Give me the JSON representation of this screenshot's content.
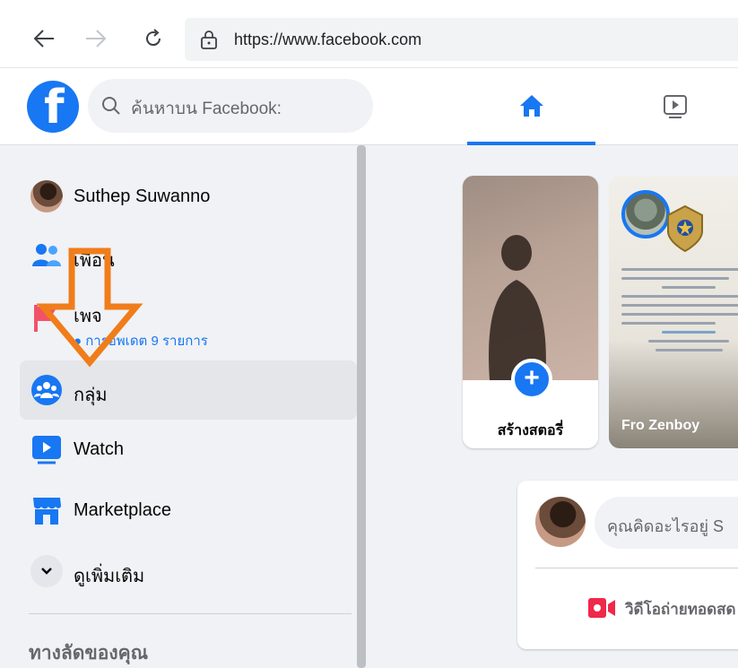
{
  "browser": {
    "url": "https://www.facebook.com"
  },
  "header": {
    "logo_letter": "f",
    "search_placeholder": "ค้นหาบน Facebook:"
  },
  "sidebar": {
    "items": [
      {
        "label": "Suthep Suwanno"
      },
      {
        "label": "เพื่อน"
      },
      {
        "label": "เพจ",
        "sub": "● การอัพเดต 9 รายการ"
      },
      {
        "label": "กลุ่ม"
      },
      {
        "label": "Watch"
      },
      {
        "label": "Marketplace"
      },
      {
        "label": "ดูเพิ่มเติม"
      }
    ],
    "shortcuts_title": "ทางลัดของคุณ"
  },
  "stories": {
    "create_label": "สร้างสตอรี่",
    "create_plus": "+",
    "friend_name": "Fro Zenboy"
  },
  "composer": {
    "placeholder": "คุณคิดอะไรอยู่ S",
    "live_label": "วิดีโอถ่ายทอดสด"
  },
  "colors": {
    "accent": "#1877f2",
    "arrow": "#f07d1a",
    "live": "#f02849"
  }
}
